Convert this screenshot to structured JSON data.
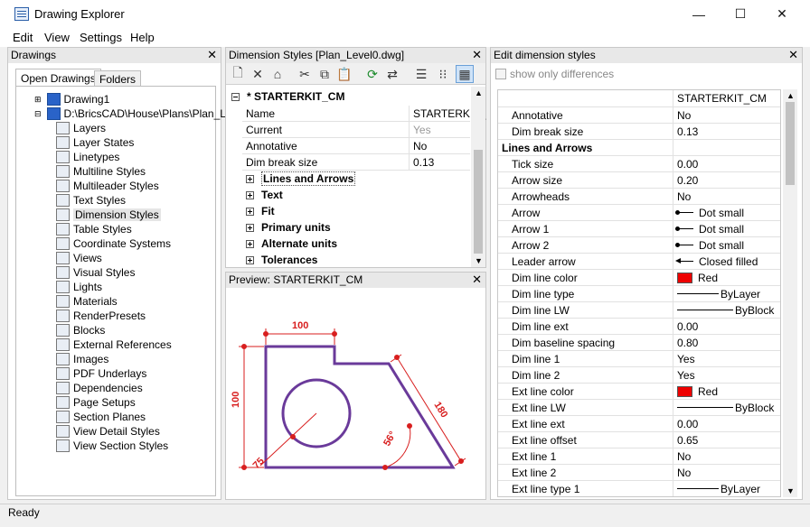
{
  "window": {
    "title": "Drawing Explorer",
    "min": "—",
    "max": "☐",
    "close": "✕"
  },
  "menu": [
    "Edit",
    "View",
    "Settings",
    "Help"
  ],
  "drawings_panel": {
    "title": "Drawings",
    "tabs": [
      "Open Drawings",
      "Folders"
    ],
    "root": "Drawing1",
    "file": "D:\\BricsCAD\\House\\Plans\\Plan_Lev",
    "items": [
      "Layers",
      "Layer States",
      "Linetypes",
      "Multiline Styles",
      "Multileader Styles",
      "Text Styles",
      "Dimension Styles",
      "Table Styles",
      "Coordinate Systems",
      "Views",
      "Visual Styles",
      "Lights",
      "Materials",
      "RenderPresets",
      "Blocks",
      "External References",
      "Images",
      "PDF Underlays",
      "Dependencies",
      "Page Setups",
      "Section Planes",
      "View Detail Styles",
      "View Section Styles"
    ],
    "selected": "Dimension Styles"
  },
  "dimstyles_panel": {
    "title": "Dimension Styles [Plan_Level0.dwg]",
    "style_name": "* STARTERKIT_CM",
    "rows": [
      {
        "name": "Name",
        "value": "STARTERKIT_"
      },
      {
        "name": "Current",
        "value": "Yes"
      },
      {
        "name": "Annotative",
        "value": "No"
      },
      {
        "name": "Dim break size",
        "value": "0.13"
      }
    ],
    "groups": [
      "Lines and Arrows",
      "Text",
      "Fit",
      "Primary units",
      "Alternate units",
      "Tolerances"
    ]
  },
  "preview_panel": {
    "title": "Preview: STARTERKIT_CM",
    "dims": {
      "top": "100",
      "left": "100",
      "diag": "180",
      "angle": "56°",
      "radius": "75"
    },
    "accent": "#d81e1e",
    "outline": "#6a3a9a"
  },
  "edit_panel": {
    "title": "Edit dimension styles",
    "checkbox_label": "show only differences",
    "header": "STARTERKIT_CM",
    "rows": [
      {
        "name": "Annotative",
        "value": "No"
      },
      {
        "name": "Dim break size",
        "value": "0.13"
      },
      {
        "name": "Lines and Arrows",
        "value": "",
        "cat": true
      },
      {
        "name": "Tick size",
        "value": "0.00"
      },
      {
        "name": "Arrow size",
        "value": "0.20"
      },
      {
        "name": "Arrowheads",
        "value": "No"
      },
      {
        "name": "Arrow",
        "value": "Dot small",
        "kind": "dot"
      },
      {
        "name": "Arrow 1",
        "value": "Dot small",
        "kind": "dot"
      },
      {
        "name": "Arrow 2",
        "value": "Dot small",
        "kind": "dot"
      },
      {
        "name": "Leader arrow",
        "value": "Closed filled",
        "kind": "fill"
      },
      {
        "name": "Dim line color",
        "value": "Red",
        "kind": "color"
      },
      {
        "name": "Dim line type",
        "value": "ByLayer",
        "kind": "line"
      },
      {
        "name": "Dim line LW",
        "value": "ByBlock",
        "kind": "longline"
      },
      {
        "name": "Dim line ext",
        "value": "0.00"
      },
      {
        "name": "Dim baseline spacing",
        "value": "0.80"
      },
      {
        "name": "Dim line 1",
        "value": "Yes"
      },
      {
        "name": "Dim line 2",
        "value": "Yes"
      },
      {
        "name": "Ext line color",
        "value": "Red",
        "kind": "color"
      },
      {
        "name": "Ext line LW",
        "value": "ByBlock",
        "kind": "longline"
      },
      {
        "name": "Ext line ext",
        "value": "0.00"
      },
      {
        "name": "Ext line offset",
        "value": "0.65"
      },
      {
        "name": "Ext line 1",
        "value": "No"
      },
      {
        "name": "Ext line 2",
        "value": "No"
      },
      {
        "name": "Ext line type 1",
        "value": "ByLayer",
        "kind": "line"
      }
    ]
  },
  "status": "Ready"
}
